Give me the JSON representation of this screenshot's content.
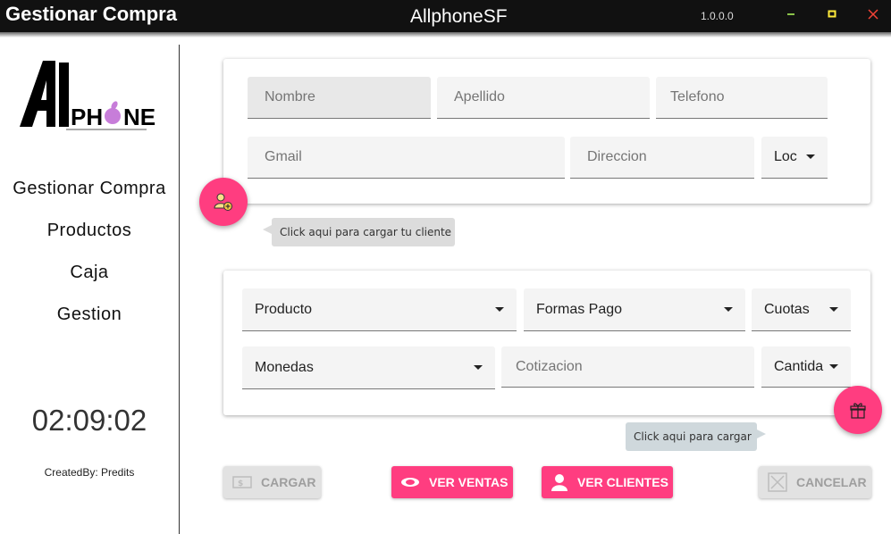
{
  "window": {
    "title": "Gestionar Compra",
    "app_name": "AllphoneSF",
    "version": "1.0.0.0",
    "minimize_icon": "minimize-icon",
    "maximize_icon": "maximize-icon",
    "close_icon": "close-icon"
  },
  "sidebar": {
    "logo_text": "ALLPHONE",
    "items": [
      {
        "label": "Gestionar Compra"
      },
      {
        "label": "Productos"
      },
      {
        "label": "Caja"
      },
      {
        "label": "Gestion"
      }
    ],
    "clock": "02:09:02",
    "credit": "CreatedBy: Predits"
  },
  "client_form": {
    "nombre_placeholder": "Nombre",
    "apellido_placeholder": "Apellido",
    "telefono_placeholder": "Telefono",
    "gmail_placeholder": "Gmail",
    "direccion_placeholder": "Direccion",
    "localidad_value": "Loc",
    "fab_icon": "add-user-icon",
    "tooltip": "Click aqui para cargar tu cliente"
  },
  "sale_form": {
    "producto": "Producto",
    "formas_pago": "Formas Pago",
    "cuotas": "Cuotas",
    "monedas": "Monedas",
    "cotizacion_placeholder": "Cotizacion",
    "cantidad": "Cantida",
    "fab_icon": "gift-box-icon",
    "tooltip": "Click aqui para cargar"
  },
  "actions": {
    "cargar": "CARGAR",
    "ver_ventas": "VER VENTAS",
    "ver_clientes": "VER CLIENTES",
    "cancelar": "CANCELAR"
  },
  "colors": {
    "accent": "#ff3d80",
    "titlebar": "#111111",
    "minimize": "#8bc34a",
    "maximize": "#ffeb3b",
    "close": "#f44336"
  }
}
